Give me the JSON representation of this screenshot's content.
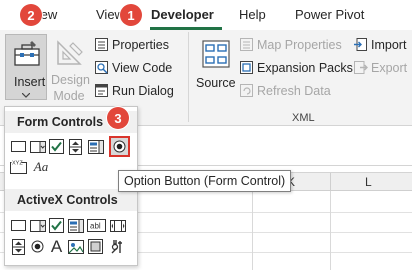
{
  "tabs": {
    "review": "eview",
    "view": "View",
    "developer": "Developer",
    "help": "Help",
    "power_pivot": "Power Pivot"
  },
  "ribbon": {
    "controls": {
      "insert": "Insert",
      "design_mode": "Design Mode",
      "properties": "Properties",
      "view_code": "View Code",
      "run_dialog": "Run Dialog"
    },
    "xml": {
      "source": "Source",
      "map_properties": "Map Properties",
      "expansion_packs": "Expansion Packs",
      "refresh_data": "Refresh Data",
      "import": "Import",
      "export": "Export",
      "group_label": "XML"
    }
  },
  "dropdown": {
    "form_controls_header": "Form Controls",
    "activex_controls_header": "ActiveX Controls",
    "label_aa": "Aa",
    "label_xyz": "XYZ",
    "label_a": "A",
    "label_abl": "abl"
  },
  "sheet": {
    "column_headers": [
      "K",
      "L"
    ]
  },
  "tooltip": {
    "text": "Option Button (Form Control)"
  },
  "badges": {
    "one": "1",
    "two": "2",
    "three": "3"
  },
  "colors": {
    "accent_green": "#217346",
    "badge_red": "#e2473b",
    "highlight_red": "#d9342b"
  },
  "icons": [
    "toolbox-icon",
    "ruler-triangle-icon",
    "properties-icon",
    "view-code-icon",
    "run-dialog-icon",
    "source-icon",
    "map-properties-icon",
    "expansion-packs-icon",
    "refresh-data-icon",
    "import-icon",
    "export-icon",
    "button-control-icon",
    "combo-box-icon",
    "check-box-icon",
    "spin-button-icon",
    "list-box-icon",
    "option-button-icon",
    "group-box-icon",
    "label-icon",
    "scroll-bar-icon",
    "text-box-icon",
    "toggle-button-icon",
    "image-icon",
    "more-controls-icon"
  ]
}
